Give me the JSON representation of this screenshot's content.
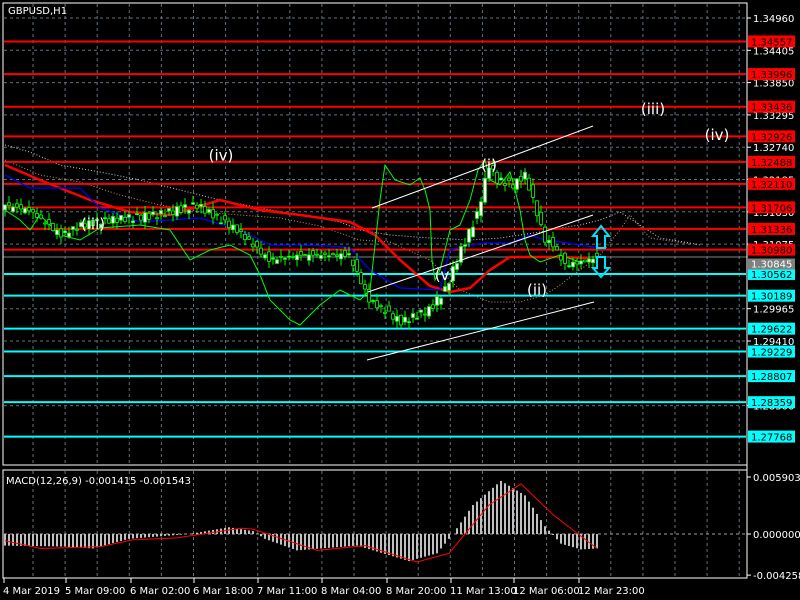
{
  "window": {
    "symbol_title": "GBPUSD,H1"
  },
  "macd_title": "MACD(12,26,9) -0.001415 -0.001543",
  "chart_data": {
    "type": "candlestick",
    "symbol": "GBPUSD",
    "timeframe": "H1",
    "price_axis": {
      "range": [
        1.274,
        1.352
      ],
      "tick_labels": [
        "1.34960",
        "1.34405",
        "1.33850",
        "1.33295",
        "1.32740",
        "1.32185",
        "1.31630",
        "1.31075",
        "1.29965",
        "1.29410",
        "1.28300"
      ],
      "current_price_label": "1.30845",
      "current_price": 1.30845
    },
    "resistance_levels": [
      {
        "label": "1.34557",
        "value": 1.34557
      },
      {
        "label": "1.33996",
        "value": 1.33996
      },
      {
        "label": "1.33436",
        "value": 1.33436
      },
      {
        "label": "1.32926",
        "value": 1.32926
      },
      {
        "label": "1.32488",
        "value": 1.32488
      },
      {
        "label": "1.32110",
        "value": 1.3211
      },
      {
        "label": "1.31706",
        "value": 1.31706
      },
      {
        "label": "1.31336",
        "value": 1.31336
      },
      {
        "label": "1.30980",
        "value": 1.3098
      }
    ],
    "support_levels": [
      {
        "label": "1.30562",
        "value": 1.30562
      },
      {
        "label": "1.30189",
        "value": 1.30189
      },
      {
        "label": "1.29622",
        "value": 1.29622
      },
      {
        "label": "1.29229",
        "value": 1.29229
      },
      {
        "label": "1.28807",
        "value": 1.28807
      },
      {
        "label": "1.28359",
        "value": 1.28359
      },
      {
        "label": "1.27768",
        "value": 1.27768
      }
    ],
    "time_labels": [
      "4 Mar 2019",
      "5 Mar 09:00",
      "6 Mar 02:00",
      "6 Mar 18:00",
      "7 Mar 11:00",
      "8 Mar 04:00",
      "8 Mar 20:00",
      "11 Mar 13:00",
      "12 Mar 06:00",
      "12 Mar 23:00"
    ],
    "close_path": [
      [
        0,
        1.31747
      ],
      [
        6,
        1.31661
      ],
      [
        14,
        1.31231
      ],
      [
        19,
        1.31403
      ],
      [
        26,
        1.31489
      ],
      [
        38,
        1.31575
      ],
      [
        48,
        1.31747
      ],
      [
        58,
        1.31317
      ],
      [
        66,
        1.30802
      ],
      [
        74,
        1.30888
      ],
      [
        86,
        1.30888
      ],
      [
        91,
        1.30115
      ],
      [
        99,
        1.29737
      ],
      [
        106,
        1.29943
      ],
      [
        110,
        1.30286
      ],
      [
        114,
        1.30974
      ],
      [
        118,
        1.31575
      ],
      [
        121,
        1.32434
      ],
      [
        123,
        1.32177
      ],
      [
        127,
        1.32091
      ],
      [
        130,
        1.32262
      ],
      [
        132,
        1.31833
      ],
      [
        135,
        1.31146
      ],
      [
        137,
        1.3106
      ],
      [
        140,
        1.30716
      ],
      [
        144,
        1.30768
      ],
      [
        148,
        1.30845
      ]
    ],
    "wave_labels": [
      {
        "text": "(iii)",
        "price": 1.334,
        "bar": 162
      },
      {
        "text": "(i)",
        "price": 1.3243,
        "bar": 121
      },
      {
        "text": "(iv)",
        "price": 1.3295,
        "bar": 178
      },
      {
        "text": "(iv)",
        "price": 1.326,
        "bar": 54
      },
      {
        "text": "(iii)",
        "price": 1.3142,
        "bar": 22
      },
      {
        "text": "(v)",
        "price": 1.3054,
        "bar": 110
      },
      {
        "text": "(ii)",
        "price": 1.3029,
        "bar": 133
      }
    ],
    "macd": {
      "params": "12,26,9",
      "main": -0.001415,
      "signal": -0.001543,
      "axis_labels": [
        "0.005903",
        "0.000000",
        "-0.004258"
      ],
      "range": [
        -0.004258,
        0.005903
      ],
      "histogram_path": [
        [
          0,
          -0.0012
        ],
        [
          15,
          -0.0013
        ],
        [
          22,
          -0.0015
        ],
        [
          31,
          -0.0005
        ],
        [
          46,
          0
        ],
        [
          56,
          0.0007
        ],
        [
          62,
          0.0003
        ],
        [
          65,
          -0.0005
        ],
        [
          73,
          -0.0017
        ],
        [
          88,
          -0.0012
        ],
        [
          101,
          -0.0028
        ],
        [
          108,
          -0.002
        ],
        [
          112,
          0
        ],
        [
          117,
          0.003
        ],
        [
          124,
          0.0055
        ],
        [
          130,
          0.004
        ],
        [
          135,
          0.0008
        ],
        [
          139,
          -0.001
        ],
        [
          144,
          -0.0016
        ],
        [
          148,
          -0.0015
        ]
      ],
      "signal_path": [
        [
          0,
          -0.0007
        ],
        [
          9,
          -0.0015
        ],
        [
          24,
          -0.0013
        ],
        [
          32,
          -0.0006
        ],
        [
          43,
          -0.0004
        ],
        [
          59,
          0.0006
        ],
        [
          62,
          0.0005
        ],
        [
          78,
          -0.0017
        ],
        [
          90,
          -0.0012
        ],
        [
          103,
          -0.0029
        ],
        [
          111,
          -0.002
        ],
        [
          121,
          0.003
        ],
        [
          129,
          0.0052
        ],
        [
          137,
          0.002
        ],
        [
          148,
          -0.0015
        ]
      ]
    },
    "colors": {
      "resistance": "#ff0000",
      "support": "#00ffff",
      "candle": "#00ff00",
      "histogram": "#c0c0c0",
      "signal": "#ff0000",
      "kijun": "#ff0000",
      "tenkan": "#0000ff"
    }
  }
}
